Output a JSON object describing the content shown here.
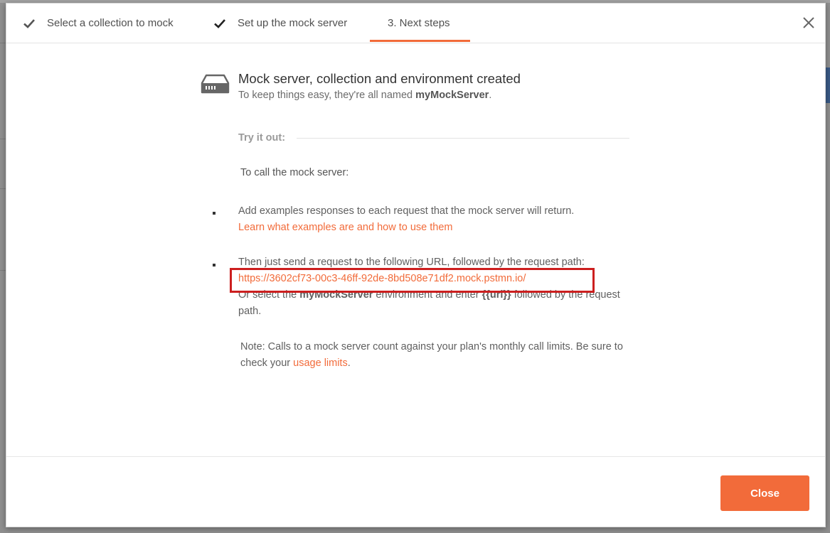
{
  "wizard": {
    "steps": [
      {
        "label": "Select a collection to mock",
        "done": true
      },
      {
        "label": "Set up the mock server",
        "done": true
      },
      {
        "label": "3. Next steps",
        "done": false
      }
    ]
  },
  "header": {
    "title": "Mock server, collection and environment created",
    "subtitle_prefix": "To keep things easy, they're all named ",
    "subtitle_name": "myMockServer",
    "subtitle_suffix": "."
  },
  "try_it": {
    "label": "Try it out:",
    "call_text": "To call the mock server:",
    "step1_text": "Add examples responses to each request that the mock server will return.",
    "step1_link": "Learn what examples are and how to use them",
    "step2_text": "Then just send a request to the following URL, followed by the request path:",
    "mock_url": "https://3602cf73-00c3-46ff-92de-8bd508e71df2.mock.pstmn.io/",
    "step2_alt_prefix": "Or select the ",
    "step2_alt_env": "myMockServer",
    "step2_alt_middle": " environment and enter ",
    "step2_alt_var": "{{url}}",
    "step2_alt_suffix": " followed by the request path."
  },
  "note": {
    "text": "Note: Calls to a mock server count against your plan's monthly call limits. Be sure to check your ",
    "link": "usage limits",
    "suffix": "."
  },
  "footer": {
    "close_label": "Close"
  },
  "colors": {
    "accent": "#f26b3a",
    "highlight_box": "#cc1f1f"
  }
}
